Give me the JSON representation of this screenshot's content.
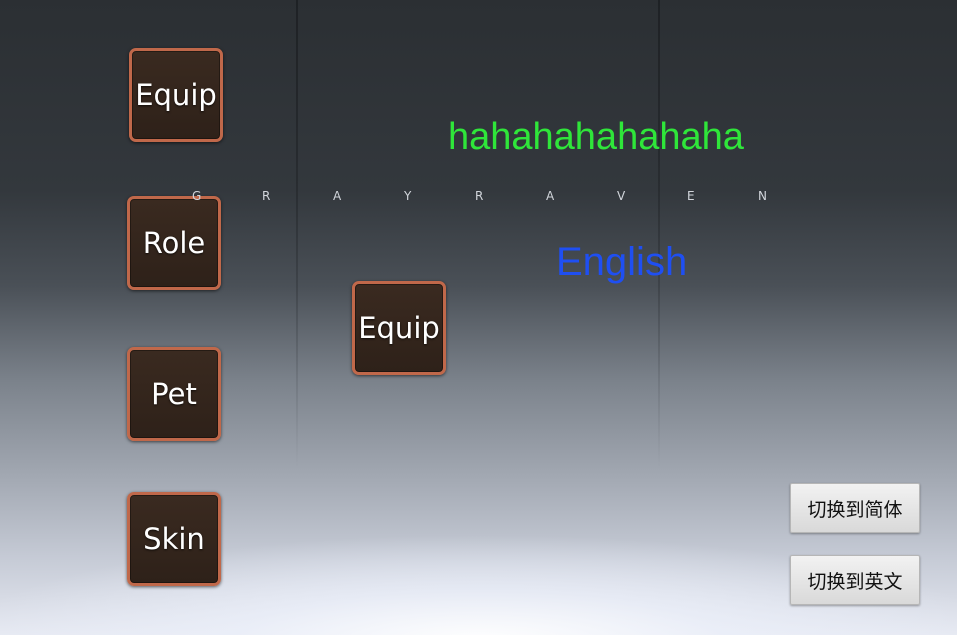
{
  "left_menu": {
    "buttons": [
      {
        "label": "Equip"
      },
      {
        "label": "Role"
      },
      {
        "label": "Pet"
      },
      {
        "label": "Skin"
      }
    ]
  },
  "center_button": {
    "label": "Equip"
  },
  "texts": {
    "headline": "hahahahahahaha",
    "language": "English"
  },
  "logo": {
    "letters": [
      "G",
      "R",
      "A",
      "Y",
      "R",
      "A",
      "V",
      "E",
      "N"
    ]
  },
  "language_buttons": {
    "simplified": "切换到简体",
    "english": "切换到英文"
  },
  "colors": {
    "headline": "#2fe63a",
    "language": "#1f4ff2",
    "tile_border": "#c0684a",
    "tile_fill": "#2e2119"
  }
}
